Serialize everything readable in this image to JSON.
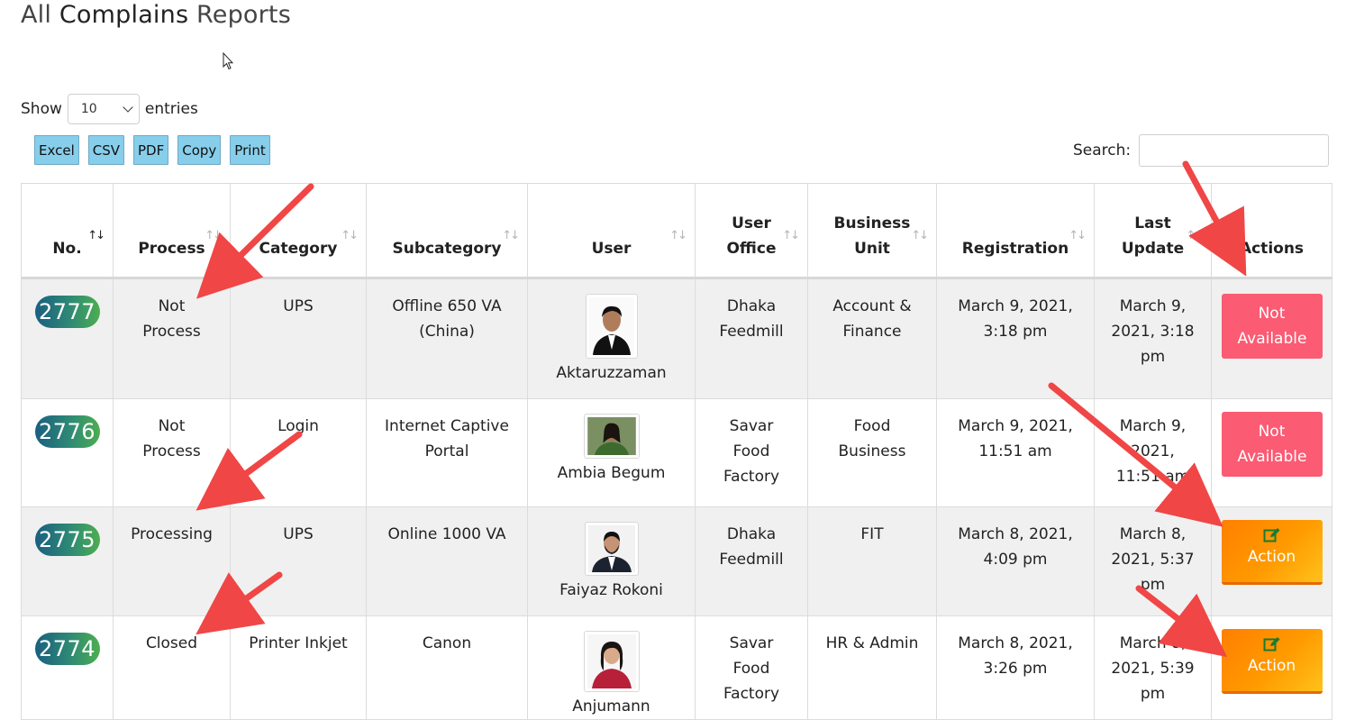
{
  "page": {
    "title_prefix": "All",
    "title_main": "Complains",
    "title_suffix": "Reports"
  },
  "length": {
    "show_label": "Show",
    "value": "10",
    "entries_label": "entries"
  },
  "export_buttons": [
    "Excel",
    "CSV",
    "PDF",
    "Copy",
    "Print"
  ],
  "search": {
    "label": "Search:",
    "value": ""
  },
  "table": {
    "columns": [
      "No.",
      "Process",
      "Category",
      "Subcategory",
      "User",
      "User Office",
      "Business Unit",
      "Registration",
      "Last Update",
      "Actions"
    ],
    "rows": [
      {
        "no": "2777",
        "process": "Not Process",
        "category": "UPS",
        "subcategory": "Offline 650 VA (China)",
        "user": "Aktaruzzaman",
        "office": "Dhaka Feedmill",
        "unit": "Account & Finance",
        "registration": "March 9, 2021, 3:18 pm",
        "last_update": "March 9, 2021, 3:18 pm",
        "action": "Not Available"
      },
      {
        "no": "2776",
        "process": "Not Process",
        "category": "Login",
        "subcategory": "Internet Captive Portal",
        "user": "Ambia Begum",
        "office": "Savar Food Factory",
        "unit": "Food Business",
        "registration": "March 9, 2021, 11:51 am",
        "last_update": "March 9, 2021, 11:51 am",
        "action": "Not Available"
      },
      {
        "no": "2775",
        "process": "Processing",
        "category": "UPS",
        "subcategory": "Online 1000 VA",
        "user": "Faiyaz Rokoni",
        "office": "Dhaka Feedmill",
        "unit": "FIT",
        "registration": "March 8, 2021, 4:09 pm",
        "last_update": "March 8, 2021, 5:37 pm",
        "action": "Action"
      },
      {
        "no": "2774",
        "process": "Closed",
        "category": "Printer Inkjet",
        "subcategory": "Canon",
        "user": "Anjumann",
        "office": "Savar Food Factory",
        "unit": "HR & Admin",
        "registration": "March 8, 2021, 3:26 pm",
        "last_update": "March 8, 2021, 5:39 pm",
        "action": "Action"
      }
    ]
  },
  "colors": {
    "not_available": "#fb5b73",
    "action": "#ff9a00",
    "badge_start": "#1a5f80",
    "badge_end": "#4cae4f",
    "export_button": "#87ceeb",
    "annotation_arrow": "#f04646"
  },
  "icons": {
    "sort": "sort-arrows-icon",
    "action": "edit-icon",
    "select": "chevron-down-icon"
  }
}
